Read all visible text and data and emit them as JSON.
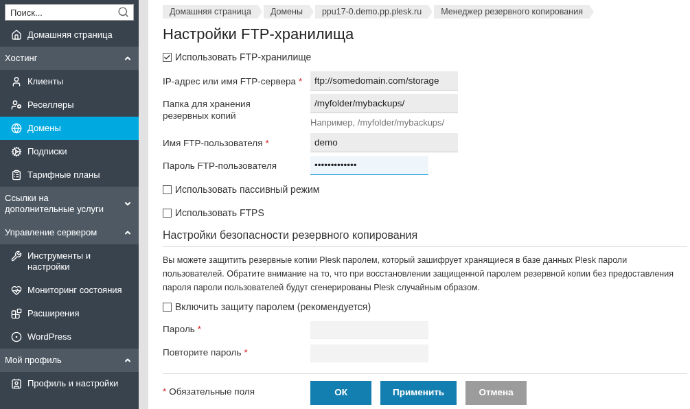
{
  "sidebar": {
    "search": {
      "placeholder": "Поиск..."
    },
    "home": {
      "label": "Домашняя страница",
      "selected": false
    },
    "groups": [
      {
        "title": "Хостинг",
        "expanded": true,
        "items": [
          {
            "label": "Клиенты",
            "selected": false
          },
          {
            "label": "Реселлеры",
            "selected": false
          },
          {
            "label": "Домены",
            "selected": true
          },
          {
            "label": "Подписки",
            "selected": false
          },
          {
            "label": "Тарифные планы",
            "selected": false
          }
        ]
      },
      {
        "title": "Ссылки на дополнительные услуги",
        "expanded": false
      },
      {
        "title": "Управление сервером",
        "expanded": true,
        "items": [
          {
            "label": "Инструменты и настройки",
            "selected": false
          },
          {
            "label": "Мониторинг состояния",
            "selected": false
          },
          {
            "label": "Расширения",
            "selected": false
          },
          {
            "label": "WordPress",
            "selected": false
          }
        ]
      },
      {
        "title": "Мой профиль",
        "expanded": true,
        "items": [
          {
            "label": "Профиль и настройки",
            "selected": false
          }
        ]
      }
    ]
  },
  "breadcrumbs": [
    "Домашняя страница",
    "Домены",
    "ppu17-0.demo.pp.plesk.ru",
    "Менеджер резервного копирования"
  ],
  "title": "Настройки FTP-хранилища",
  "use_ftp": {
    "label": "Использовать FTP-хранилище",
    "checked": true
  },
  "fields": [
    {
      "label": "IP-адрес или имя FTP-сервера",
      "required": true,
      "value": "ftp://somedomain.com/storage",
      "focused": false
    },
    {
      "label": "Папка для хранения резервных копий",
      "required": false,
      "value": "/myfolder/mybackups/",
      "hint": "Например, /myfolder/mybackups/",
      "focused": false
    },
    {
      "label": "Имя FTP-пользователя",
      "required": true,
      "value": "demo",
      "focused": false
    },
    {
      "label": "Пароль FTP-пользователя",
      "required": false,
      "value": "•••••••••••••",
      "focused": true,
      "short": true
    }
  ],
  "options": [
    {
      "label": "Использовать пассивный режим",
      "checked": false
    },
    {
      "label": "Использовать FTPS",
      "checked": false
    }
  ],
  "security": {
    "heading": "Настройки безопасности резервного копирования",
    "text": "Вы можете защитить резервные копии Plesk паролем, который зашифрует хранящиеся в базе данных Plesk пароли пользователей. Обратите внимание на то, что при восстановлении защищенной паролем резервной копии без предоставления пароля пароли пользователей будут сгенерированы Plesk случайным образом.",
    "protect": {
      "label": "Включить защиту паролем (рекомендуется)",
      "checked": false
    },
    "fields": [
      {
        "label": "Пароль",
        "required": true,
        "disabled": true
      },
      {
        "label": "Повторите пароль",
        "required": true,
        "disabled": true
      }
    ]
  },
  "required_note": "Обязательные поля",
  "asterisk": "*",
  "buttons": [
    {
      "label": "ОК",
      "kind": "primary"
    },
    {
      "label": "Применить",
      "kind": "primary"
    },
    {
      "label": "Отмена",
      "kind": "cancel"
    }
  ]
}
